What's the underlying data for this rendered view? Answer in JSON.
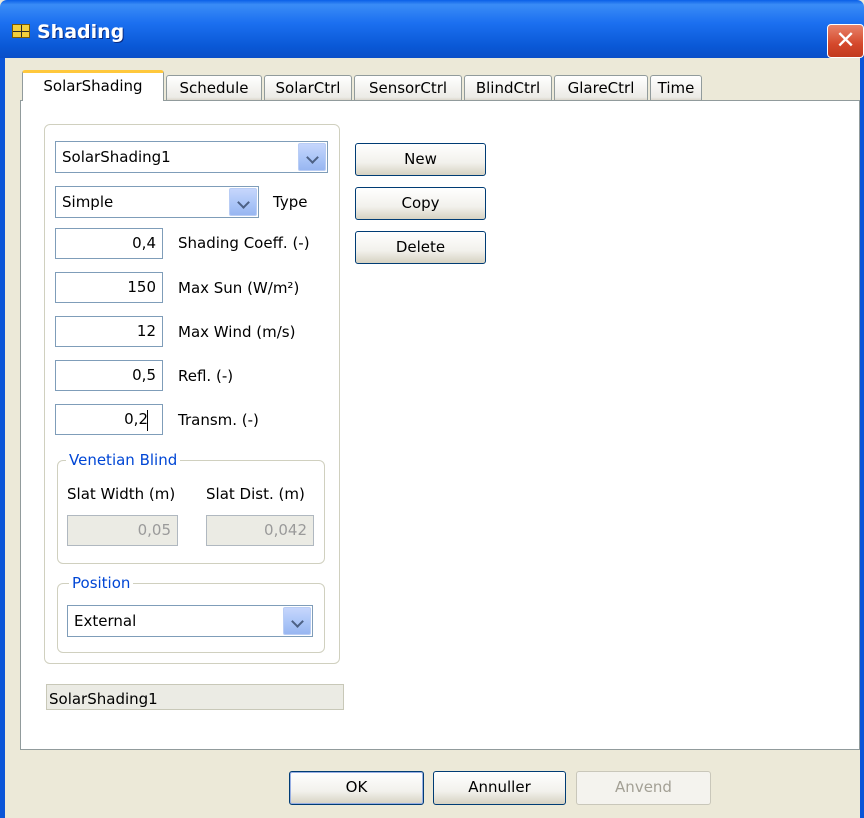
{
  "window": {
    "title": "Shading",
    "close_label": "✕"
  },
  "tabs": [
    {
      "label": "SolarShading"
    },
    {
      "label": "Schedule"
    },
    {
      "label": "SolarCtrl"
    },
    {
      "label": "SensorCtrl"
    },
    {
      "label": "BlindCtrl"
    },
    {
      "label": "GlareCtrl"
    },
    {
      "label": "Time"
    }
  ],
  "shading": {
    "selected": "SolarShading1",
    "type_value": "Simple",
    "type_label": "Type",
    "fields": [
      {
        "value": "0,4",
        "label": "Shading Coeff. (-)"
      },
      {
        "value": "150",
        "label": "Max Sun (W/m²)"
      },
      {
        "value": "12",
        "label": "Max Wind (m/s)"
      },
      {
        "value": "0,5",
        "label": "Refl. (-)"
      },
      {
        "value": "0,2",
        "label": "Transm. (-)"
      }
    ]
  },
  "venetian": {
    "title": "Venetian Blind",
    "slat_width_label": "Slat Width (m)",
    "slat_dist_label": "Slat Dist. (m)",
    "slat_width_value": "0,05",
    "slat_dist_value": "0,042"
  },
  "position": {
    "title": "Position",
    "value": "External"
  },
  "actions": {
    "new": "New",
    "copy": "Copy",
    "delete": "Delete"
  },
  "status_text": "SolarShading1",
  "footer": {
    "ok": "OK",
    "cancel": "Annuller",
    "apply": "Anvend"
  }
}
